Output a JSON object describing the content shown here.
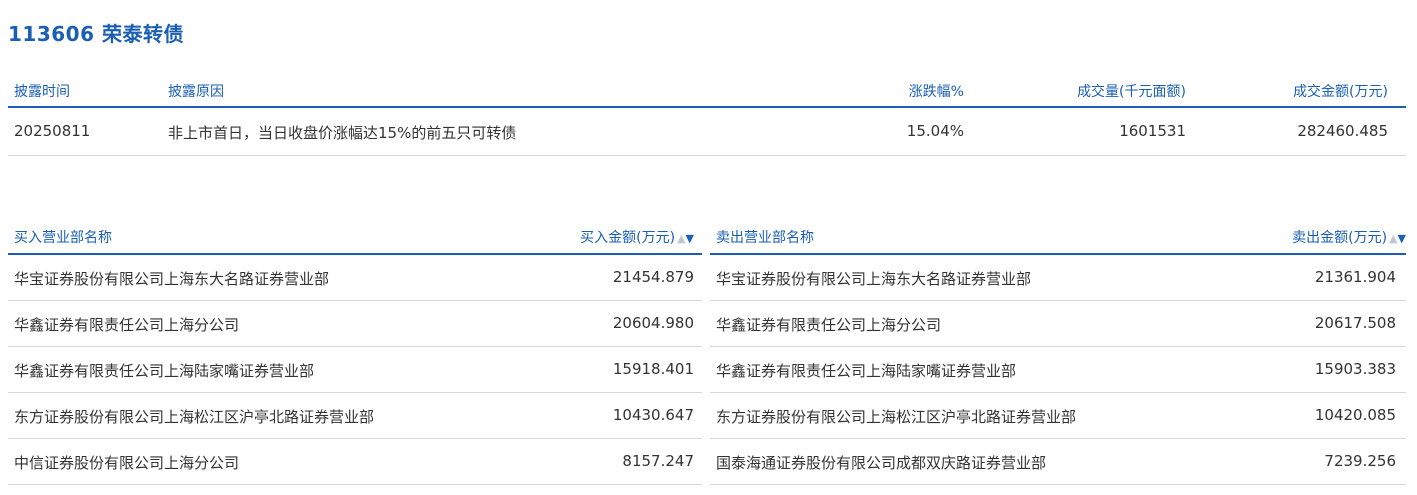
{
  "title": "113606 荣泰转债",
  "disclosure": {
    "headers": {
      "time": "披露时间",
      "reason": "披露原因",
      "change": "涨跌幅%",
      "volume": "成交量(千元面额)",
      "amount": "成交金额(万元)"
    },
    "rows": [
      {
        "time": "20250811",
        "reason": "非上市首日，当日收盘价涨幅达15%的前五只可转债",
        "change": "15.04%",
        "volume": "1601531",
        "amount": "282460.485"
      }
    ]
  },
  "buy": {
    "header_name": "买入营业部名称",
    "header_amount": "买入金额(万元)",
    "sort_up": "▲",
    "sort_down": "▼",
    "rows": [
      {
        "name": "华宝证券股份有限公司上海东大名路证券营业部",
        "amount": "21454.879"
      },
      {
        "name": "华鑫证券有限责任公司上海分公司",
        "amount": "20604.980"
      },
      {
        "name": "华鑫证券有限责任公司上海陆家嘴证券营业部",
        "amount": "15918.401"
      },
      {
        "name": "东方证券股份有限公司上海松江区沪亭北路证券营业部",
        "amount": "10430.647"
      },
      {
        "name": "中信证券股份有限公司上海分公司",
        "amount": "8157.247"
      }
    ]
  },
  "sell": {
    "header_name": "卖出营业部名称",
    "header_amount": "卖出金额(万元)",
    "sort_up": "▲",
    "sort_down": "▼",
    "rows": [
      {
        "name": "华宝证券股份有限公司上海东大名路证券营业部",
        "amount": "21361.904"
      },
      {
        "name": "华鑫证券有限责任公司上海分公司",
        "amount": "20617.508"
      },
      {
        "name": "华鑫证券有限责任公司上海陆家嘴证券营业部",
        "amount": "15903.383"
      },
      {
        "name": "东方证券股份有限公司上海松江区沪亭北路证券营业部",
        "amount": "10420.085"
      },
      {
        "name": "国泰海通证券股份有限公司成都双庆路证券营业部",
        "amount": "7239.256"
      }
    ]
  },
  "colors": {
    "accent": "#1a5fb4",
    "text": "#333333",
    "divider": "#d8d8d8",
    "sort_inactive": "#bfc8d6"
  }
}
